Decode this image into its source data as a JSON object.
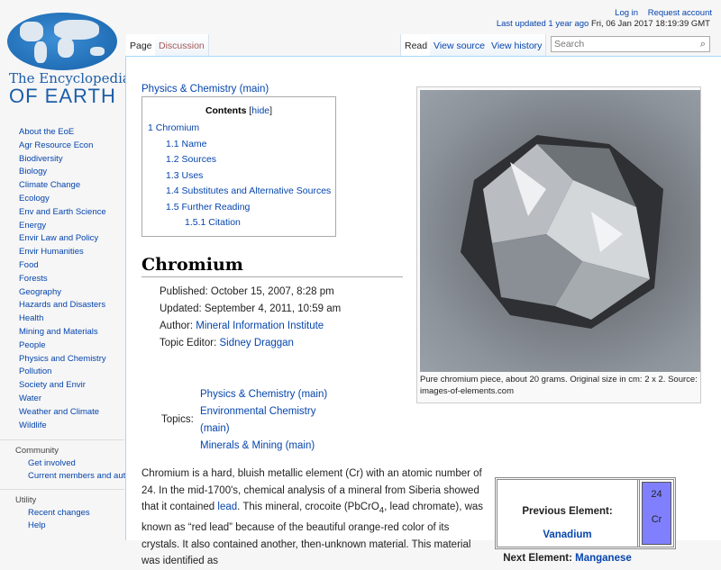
{
  "logo": {
    "line1": "The Encyclopedia",
    "line2": "OF EARTH"
  },
  "header": {
    "login": "Log in",
    "request_account": "Request account",
    "last_updated_label": "Last updated",
    "last_updated_ago": "1 year ago",
    "last_updated_date": "Fri, 06 Jan 2017 18:19:39 GMT"
  },
  "tabs": {
    "page": "Page",
    "discussion": "Discussion",
    "read": "Read",
    "view_source": "View source",
    "view_history": "View history"
  },
  "search": {
    "placeholder": "Search"
  },
  "sidebar": {
    "items": [
      "About the EoE",
      "Agr Resource Econ",
      "Biodiversity",
      "Biology",
      "Climate Change",
      "Ecology",
      "Env and Earth Science",
      "Energy",
      "Envir Law and Policy",
      "Envir Humanities",
      "Food",
      "Forests",
      "Geography",
      "Hazards and Disasters",
      "Health",
      "Mining and Materials",
      "People",
      "Physics and Chemistry",
      "Pollution",
      "Society and Envir",
      "Water",
      "Weather and Climate",
      "Wildlife"
    ],
    "community": {
      "title": "Community",
      "items": [
        "Get involved",
        "Current members and authors"
      ]
    },
    "utility": {
      "title": "Utility",
      "items": [
        "Recent changes",
        "Help"
      ]
    }
  },
  "breadcrumb": "Physics & Chemistry (main)",
  "toc": {
    "title": "Contents",
    "hide": "hide",
    "entries": [
      "1 Chromium",
      "1.1 Name",
      "1.2 Sources",
      "1.3 Uses",
      "1.4 Substitutes and Alternative Sources",
      "1.5 Further Reading",
      "1.5.1 Citation"
    ]
  },
  "article": {
    "title": "Chromium",
    "published": "Published: October 15, 2007, 8:28 pm",
    "updated": "Updated: September 4, 2011, 10:59 am",
    "author_label": "Author:",
    "author": "Mineral Information Institute",
    "editor_label": "Topic Editor:",
    "editor": "Sidney Draggan",
    "topics_label": "Topics:",
    "topics": [
      "Physics & Chemistry (main)",
      "Environmental Chemistry (main)",
      "Minerals & Mining (main)"
    ],
    "p1_a": "Chromium is a hard, bluish metallic element (Cr) with an atomic number of 24. In the mid-1700's, chemical analysis of a mineral from Siberia showed that it contained ",
    "p1_link": "lead",
    "p1_b": ". This mineral, crocoite (PbCrO",
    "p1_sub": "4",
    "p1_c": ", lead chromate), was known as “red lead” because of the beautiful orange-red color of its crystals. It also contained another, then-unknown material. This material was identified as"
  },
  "figure": {
    "caption": "Pure chromium piece, about 20 grams. Original size in cm: 2 x 2. Source: images-of-elements.com"
  },
  "element_box": {
    "prev_label": "Previous Element:",
    "prev": "Vanadium",
    "next_label": "Next Element:",
    "next": "Manganese",
    "number": "24",
    "symbol": "Cr",
    "color": "#8080ff"
  }
}
